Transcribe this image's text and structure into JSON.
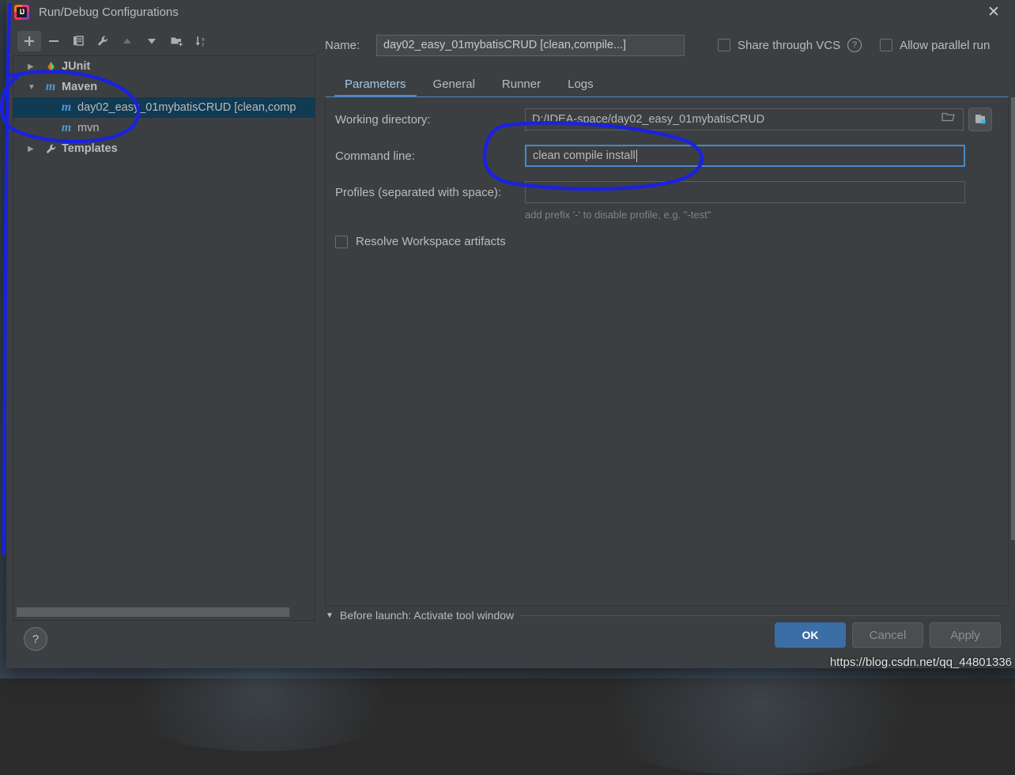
{
  "window": {
    "title": "Run/Debug Configurations",
    "logo_icon": "intellij-idea-logo",
    "close_icon": "close-icon"
  },
  "toolbar": {
    "buttons": [
      {
        "name": "add",
        "icon": "plus-icon",
        "label": "+",
        "state": "active"
      },
      {
        "name": "remove",
        "icon": "minus-icon",
        "label": "−",
        "state": "enabled"
      },
      {
        "name": "copy",
        "icon": "copy-icon",
        "label": "copy",
        "state": "enabled"
      },
      {
        "name": "edit-templates",
        "icon": "wrench-icon",
        "label": "wrench",
        "state": "enabled"
      },
      {
        "name": "move-up",
        "icon": "arrow-up-icon",
        "label": "up",
        "state": "disabled"
      },
      {
        "name": "move-down",
        "icon": "arrow-down-icon",
        "label": "down",
        "state": "enabled"
      },
      {
        "name": "new-folder",
        "icon": "folder-add-icon",
        "label": "folder",
        "state": "enabled"
      },
      {
        "name": "sort-alphabetically",
        "icon": "sort-az-icon",
        "label": "sort",
        "state": "enabled"
      }
    ]
  },
  "tree": {
    "nodes": [
      {
        "label": "JUnit",
        "icon": "junit-icon",
        "twisty": "collapsed",
        "depth": 0,
        "selected": false,
        "bold": true
      },
      {
        "label": "Maven",
        "icon": "maven-m-icon",
        "twisty": "expanded",
        "depth": 0,
        "selected": false,
        "bold": true
      },
      {
        "label": "day02_easy_01mybatisCRUD [clean,comp",
        "icon": "maven-m-icon",
        "twisty": "none",
        "depth": 1,
        "selected": true,
        "bold": false
      },
      {
        "label": "mvn",
        "icon": "maven-m-icon",
        "twisty": "none",
        "depth": 1,
        "selected": false,
        "bold": false
      },
      {
        "label": "Templates",
        "icon": "wrench-icon",
        "twisty": "collapsed",
        "depth": 0,
        "selected": false,
        "bold": true
      }
    ]
  },
  "name_row": {
    "label": "Name:",
    "value": "day02_easy_01mybatisCRUD [clean,compile...]",
    "placeholder": "",
    "share_vcs_label": "Share through VCS",
    "share_vcs_checked": false,
    "share_vcs_help_icon": "question-mark-icon",
    "allow_parallel_label": "Allow parallel run",
    "allow_parallel_checked": false
  },
  "tabs": {
    "items": [
      {
        "label": "Parameters",
        "active": true
      },
      {
        "label": "General",
        "active": false
      },
      {
        "label": "Runner",
        "active": false
      },
      {
        "label": "Logs",
        "active": false
      }
    ]
  },
  "parameters": {
    "working_directory": {
      "label": "Working directory:",
      "value": "D:/IDEA-space/day02_easy_01mybatisCRUD",
      "browse_icon": "folder-open-icon",
      "macro_icon": "insert-macro-icon"
    },
    "command_line": {
      "label": "Command line:",
      "value": "clean compile install",
      "focused": true
    },
    "profiles": {
      "label": "Profiles (separated with space):",
      "value": "",
      "hint": "add prefix '-' to disable profile, e.g. \"-test\""
    },
    "resolve_workspace": {
      "label": "Resolve Workspace artifacts",
      "checked": false
    }
  },
  "before_launch": {
    "arrow_icon": "triangle-down-icon",
    "text": "Before launch: Activate tool window"
  },
  "footer": {
    "help_label": "?",
    "help_icon": "question-mark-icon",
    "ok_label": "OK",
    "cancel_label": "Cancel",
    "apply_label": "Apply"
  },
  "watermark": {
    "text": "https://blog.csdn.net/qq_44801336"
  },
  "colors": {
    "accent_blue": "#4a88c7",
    "ok_button": "#3b6ea5",
    "selection_row": "#113a53",
    "dialog_bg": "#3c3f41",
    "annotation_blue": "#1a22e0",
    "maven_icon": "#4a9ad4"
  }
}
